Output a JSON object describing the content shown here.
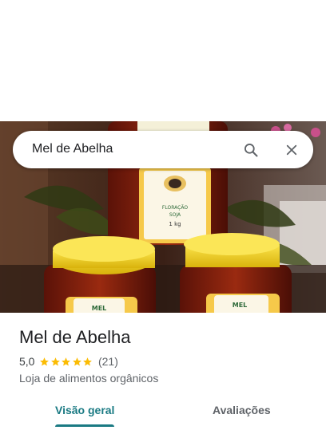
{
  "search": {
    "query": "Mel de Abelha",
    "search_icon": "search-icon",
    "close_icon": "close-icon"
  },
  "photo": {
    "jar_label_top": "FLORAÇÃO",
    "jar_label_mid": "SOJA",
    "jar_label_weight": "1 kg",
    "jar_label_small": "MEL"
  },
  "place": {
    "name": "Mel de Abelha",
    "rating": "5,0",
    "stars": 5,
    "review_count": "(21)",
    "category": "Loja de alimentos orgânicos"
  },
  "tabs": [
    {
      "label": "Visão geral",
      "active": true
    },
    {
      "label": "Avaliações",
      "active": false
    }
  ],
  "colors": {
    "accent": "#1a7a83",
    "star": "#fbbc04",
    "honey": "#8a1f0e",
    "lid": "#f2d21a"
  }
}
